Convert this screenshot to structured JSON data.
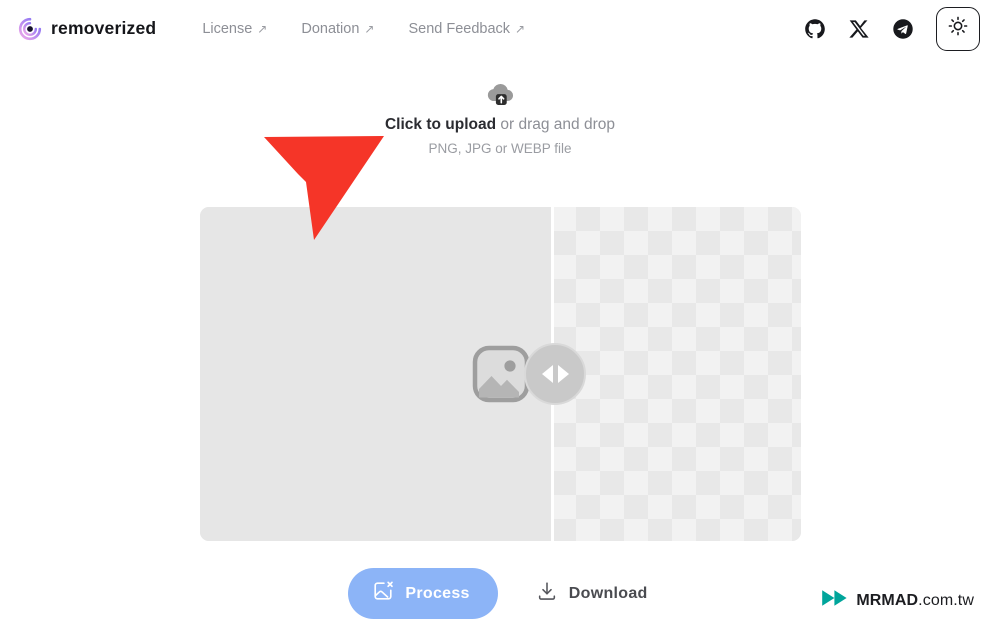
{
  "header": {
    "brand": {
      "logo_icon": "removerized-swirl-logo",
      "name": "removerized"
    },
    "nav": [
      {
        "label": "License",
        "external_glyph": "↗"
      },
      {
        "label": "Donation",
        "external_glyph": "↗"
      },
      {
        "label": "Send Feedback",
        "external_glyph": "↗"
      }
    ],
    "social": [
      {
        "name": "github-icon"
      },
      {
        "name": "x-twitter-icon"
      },
      {
        "name": "telegram-icon"
      }
    ],
    "theme_toggle": {
      "icon": "sun-icon"
    }
  },
  "upload": {
    "icon": "cloud-upload-icon",
    "action_text": "Click to upload",
    "hint_text": " or drag and drop",
    "formats": "PNG, JPG or WEBP file"
  },
  "preview": {
    "left_panel_label": "original-image-panel",
    "right_panel_label": "transparent-result-panel",
    "placeholder_icon": "image-placeholder-icon",
    "slider_icon": "left-right-compare-handle"
  },
  "annotation": {
    "arrow": "red-pointer-arrow",
    "color": "#f53528"
  },
  "actions": {
    "process_label": "Process",
    "process_icon": "image-remove-icon",
    "download_label": "Download",
    "download_icon": "download-icon"
  },
  "watermark": {
    "logo_icon": "mrmad-logo",
    "name": "MRMAD",
    "domain": ".com.tw",
    "color": "#00a59b"
  },
  "colors": {
    "accent_blue": "#8cb4f7",
    "panel_gray": "#e6e6e6",
    "text_dark": "#2b2c31",
    "text_muted": "#8d8f96",
    "annotation_red": "#f53528",
    "watermark_teal": "#00a59b"
  }
}
